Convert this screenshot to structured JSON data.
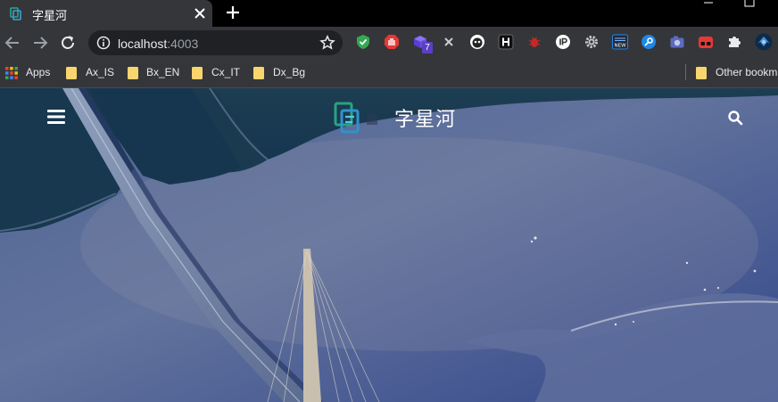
{
  "tab": {
    "title": "字星河"
  },
  "address_bar": {
    "host": "localhost",
    "port": ":4003"
  },
  "extensions": [
    {
      "icon": "shield-check-icon",
      "color": "#34a853"
    },
    {
      "icon": "hand-stop-icon",
      "color": "#e53935"
    },
    {
      "icon": "cube-badge-icon",
      "color": "#6a4fd9",
      "badge": "7"
    },
    {
      "icon": "x-extension-icon",
      "color": "#9aa0a6"
    },
    {
      "icon": "monster-icon",
      "color": "#ffffff"
    },
    {
      "icon": "h-extension-icon",
      "color": "#ffffff"
    },
    {
      "icon": "bug-icon",
      "color": "#c62828"
    },
    {
      "icon": "ip-icon",
      "color": "#ffffff"
    },
    {
      "icon": "gear-icon",
      "color": "#c7c7c7"
    },
    {
      "icon": "new-badge-icon",
      "color": "#1e88e5"
    },
    {
      "icon": "key-icon",
      "color": "#1e88e5"
    },
    {
      "icon": "camera-icon",
      "color": "#5c6bc0"
    },
    {
      "icon": "glasses-icon",
      "color": "#e53935"
    },
    {
      "icon": "puzzle-icon",
      "color": "#e8eaed"
    },
    {
      "icon": "profile-avatar-icon",
      "color": "#3f6ea8"
    }
  ],
  "bookmarks": {
    "apps_label": "Apps",
    "items": [
      {
        "label": "Ax_IS"
      },
      {
        "label": "Bx_EN"
      },
      {
        "label": "Cx_IT"
      },
      {
        "label": "Dx_Bg"
      }
    ],
    "other_label": "Other bookm"
  },
  "site": {
    "title": "字星河"
  },
  "colors": {
    "tab_strip": "#000000",
    "toolbar": "#35363a",
    "omnibox": "#202124",
    "folder": "#f9d56e"
  }
}
